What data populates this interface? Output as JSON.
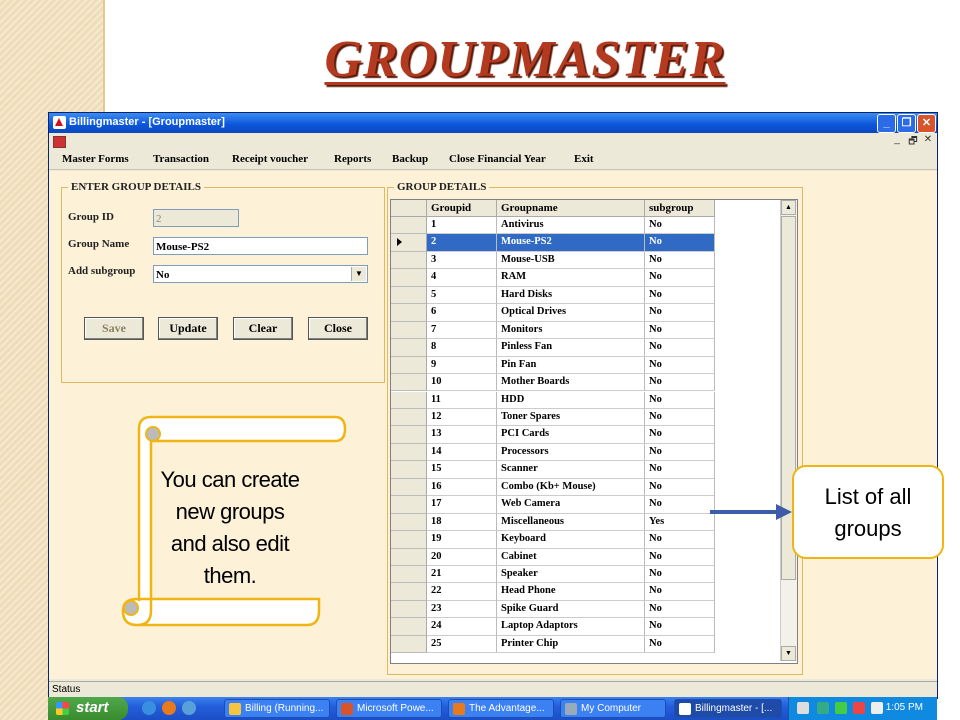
{
  "slide": {
    "title": "GROUPMASTER",
    "callout_left": [
      "You can create",
      "new groups",
      "and  also edit",
      "them."
    ],
    "callout_right": [
      "List  of  all",
      "groups"
    ]
  },
  "window": {
    "title": "Billingmaster - [Groupmaster]",
    "buttons": {
      "minimize": "_",
      "maximize": "❐",
      "close": "✕"
    },
    "mdi_controls": {
      "minimize": "_",
      "restore": "🗗",
      "close": "✕"
    }
  },
  "menu": [
    "Master Forms",
    "Transaction",
    "Receipt voucher",
    "Reports",
    "Backup",
    "Close Financial Year",
    "Exit"
  ],
  "form": {
    "legend": "ENTER GROUP DETAILS",
    "group_id_label": "Group ID",
    "group_id_value": "2",
    "group_name_label": "Group Name",
    "group_name_value": "Mouse-PS2",
    "add_subgroup_label": "Add subgroup",
    "add_subgroup_value": "No",
    "buttons": {
      "save": "Save",
      "update": "Update",
      "clear": "Clear",
      "close": "Close"
    }
  },
  "grid": {
    "legend": "GROUP DETAILS",
    "columns": [
      "Groupid",
      "Groupname",
      "subgroup"
    ],
    "selected_index": 1,
    "rows": [
      [
        "1",
        "Antivirus",
        "No"
      ],
      [
        "2",
        "Mouse-PS2",
        "No"
      ],
      [
        "3",
        "Mouse-USB",
        "No"
      ],
      [
        "4",
        "RAM",
        "No"
      ],
      [
        "5",
        "Hard Disks",
        "No"
      ],
      [
        "6",
        "Optical Drives",
        "No"
      ],
      [
        "7",
        "Monitors",
        "No"
      ],
      [
        "8",
        "Pinless Fan",
        "No"
      ],
      [
        "9",
        "Pin Fan",
        "No"
      ],
      [
        "10",
        "Mother Boards",
        "No"
      ],
      [
        "11",
        "HDD",
        "No"
      ],
      [
        "12",
        "Toner Spares",
        "No"
      ],
      [
        "13",
        "PCI Cards",
        "No"
      ],
      [
        "14",
        "Processors",
        "No"
      ],
      [
        "15",
        "Scanner",
        "No"
      ],
      [
        "16",
        "Combo (Kb+ Mouse)",
        "No"
      ],
      [
        "17",
        "Web Camera",
        "No"
      ],
      [
        "18",
        "Miscellaneous",
        "Yes"
      ],
      [
        "19",
        "Keyboard",
        "No"
      ],
      [
        "20",
        "Cabinet",
        "No"
      ],
      [
        "21",
        "Speaker",
        "No"
      ],
      [
        "22",
        "Head Phone",
        "No"
      ],
      [
        "23",
        "Spike Guard",
        "No"
      ],
      [
        "24",
        "Laptop Adaptors",
        "No"
      ],
      [
        "25",
        "Printer Chip",
        "No"
      ]
    ]
  },
  "status": "Status",
  "taskbar": {
    "start": "start",
    "tasks": [
      "Billing (Running...",
      "Microsoft Powe...",
      "The Advantage...",
      "My Computer",
      "Billingmaster - [..."
    ],
    "active_task": 4,
    "clock": "1:05 PM"
  },
  "colors": {
    "accent": "#316ac5",
    "callout_border": "#f0b515",
    "title": "#b43a1f",
    "arrow": "#3f5ca8"
  }
}
